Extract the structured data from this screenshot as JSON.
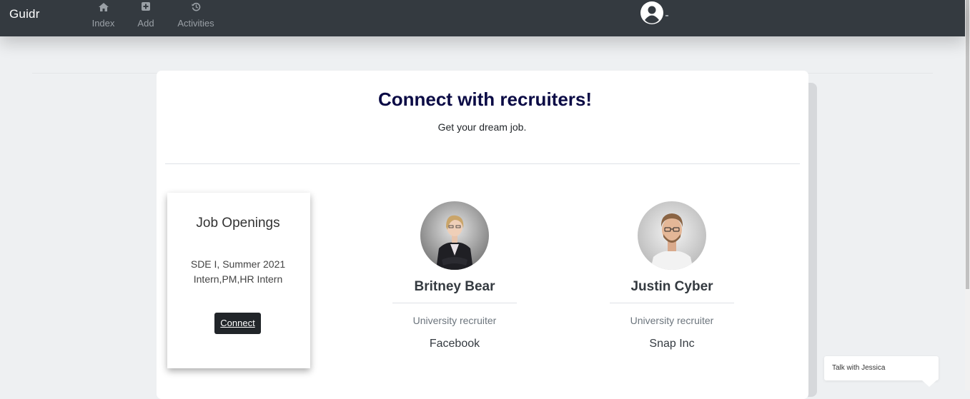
{
  "navbar": {
    "brand": "Guidr",
    "items": [
      {
        "label": "Index",
        "icon": "home-icon"
      },
      {
        "label": "Add",
        "icon": "plus-square-icon"
      },
      {
        "label": "Activities",
        "icon": "history-icon"
      }
    ],
    "profile_icon": "user-circle-icon"
  },
  "hero": {
    "title": "Connect with recruiters!",
    "subtitle": "Get your dream job."
  },
  "job_card": {
    "title": "Job Openings",
    "description": "SDE I, Summer 2021 Intern,PM,HR Intern",
    "button_label": "Connect"
  },
  "recruiters": [
    {
      "name": "Britney Bear",
      "role": "University recruiter",
      "company": "Facebook"
    },
    {
      "name": "Justin Cyber",
      "role": "University recruiter",
      "company": "Snap Inc"
    }
  ],
  "chat": {
    "label": "Talk with Jessica"
  },
  "colors": {
    "navbar": "#343a40",
    "title": "#0b0b45",
    "button": "#212529",
    "background": "#eef0f2"
  }
}
